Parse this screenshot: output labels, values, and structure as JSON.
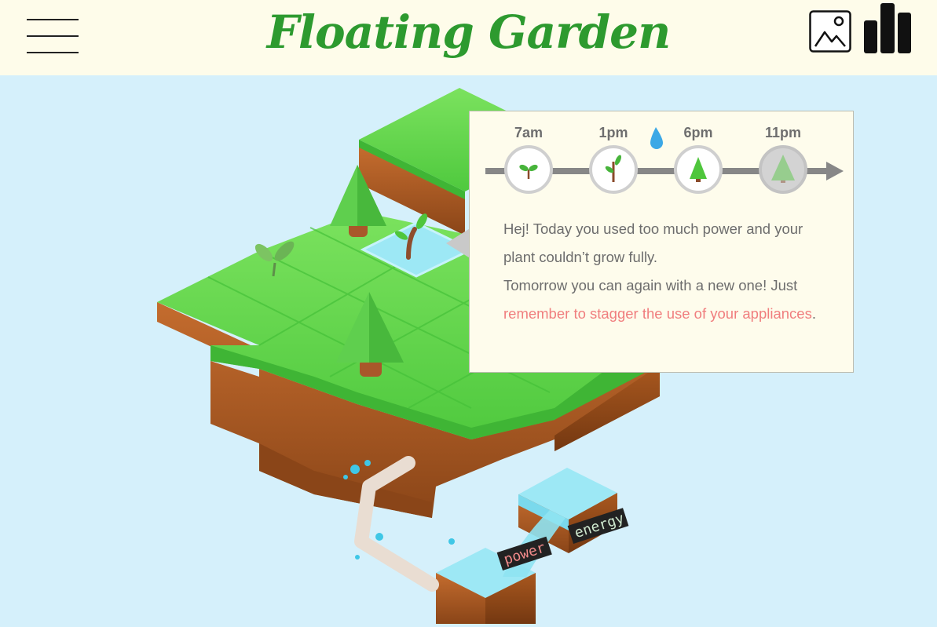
{
  "app": {
    "title": "Floating Garden"
  },
  "header": {
    "menu_icon": "hamburger-menu-icon",
    "gallery_icon": "image-gallery-icon",
    "stats_icon": "bar-chart-icon"
  },
  "timeline": {
    "slots": [
      {
        "time": "7am",
        "icon": "seedling-icon"
      },
      {
        "time": "1pm",
        "icon": "sprout-icon"
      },
      {
        "time": "6pm",
        "icon": "small-tree-icon"
      },
      {
        "time": "11pm",
        "icon": "faded-tree-icon"
      }
    ],
    "water_icon": "water-drop-icon"
  },
  "message": {
    "line1": "Hej! Today you used too much power and your plant couldn’t grow fully.",
    "line2": "Tomorrow you can again with a new one! Just",
    "tip": "remember to stagger the use of your appliances",
    "end": "."
  },
  "labels": {
    "power": "power",
    "energy": "energy"
  },
  "colors": {
    "title": "#2d9a2f",
    "header_bg": "#fefcea",
    "sky": "#d5f0fb",
    "grass": "#5ed54a",
    "soil": "#b5622a",
    "water": "#9de8f5",
    "tip": "#f07e7e"
  }
}
